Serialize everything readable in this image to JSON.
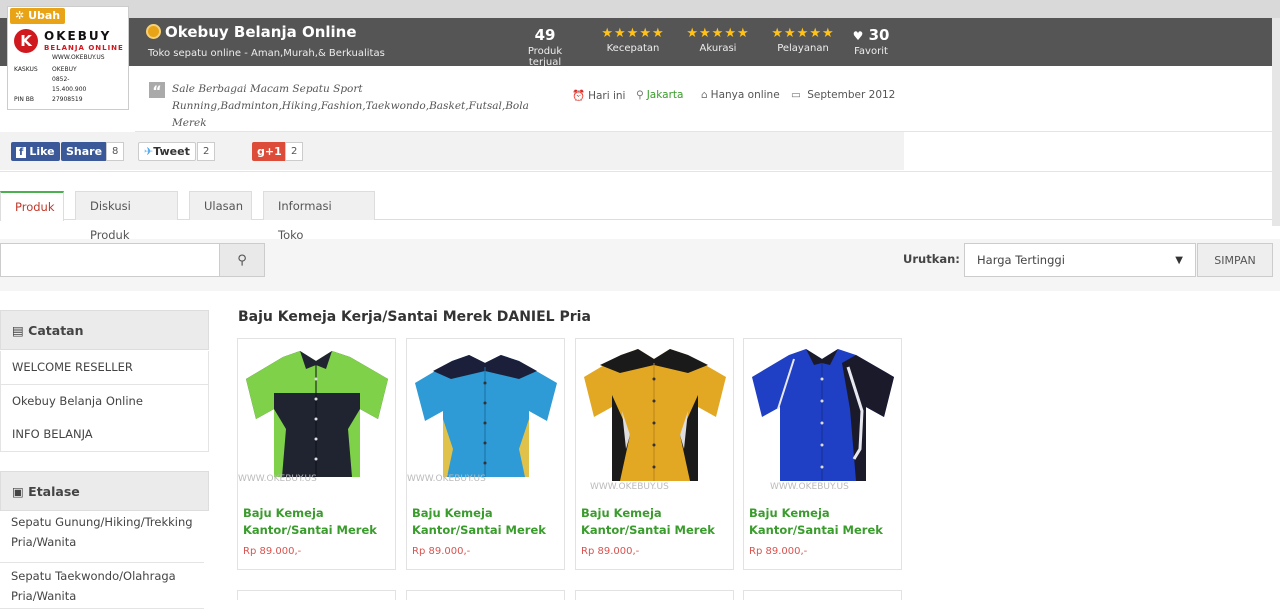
{
  "logo": {
    "edit_label": "Ubah",
    "k_letter": "K",
    "brand": "OKEBUY",
    "subtitle": "BELANJA ONLINE",
    "website": "WWW.OKEBUY.US",
    "lines": [
      {
        "a": "KASKUS",
        "b": "OKEBUY"
      },
      {
        "a": "",
        "b": "0852-15.400.900"
      },
      {
        "a": "PIN BB",
        "b": "27908519"
      }
    ]
  },
  "shop": {
    "name": "Okebuy Belanja Online",
    "tagline": "Toko sepatu online - Aman,Murah,& Berkualitas"
  },
  "stats": {
    "sold_count": "49",
    "sold_label": "Produk terjual",
    "speed_label": "Kecepatan",
    "accuracy_label": "Akurasi",
    "service_label": "Pelayanan",
    "stars": "★★★★★",
    "rating_stars": 5,
    "favorite_count": "30",
    "favorite_label": "Favorit",
    "star_color": "#ffc21a"
  },
  "description": "Sale Berbagai Macam Sepatu Sport Running,Badminton,Hiking,Fashion,Taekwondo,Basket,Futsal,Bola Merek",
  "meta": {
    "time_label": "Hari ini",
    "location_label": "Jakarta",
    "online_label": "Hanya online",
    "since_label": "September 2012"
  },
  "social": {
    "like_label": "Like",
    "share_label": "Share",
    "share_count": "8",
    "tweet_label": "Tweet",
    "tweet_count": "2",
    "gplus_label": "g+1",
    "gplus_count": "2"
  },
  "tabs": [
    {
      "label": "Produk",
      "active": true
    },
    {
      "label": "Diskusi Produk",
      "active": false
    },
    {
      "label": "Ulasan",
      "active": false
    },
    {
      "label": "Informasi Toko",
      "active": false
    }
  ],
  "search": {
    "value": "",
    "placeholder": ""
  },
  "sort": {
    "label": "Urutkan:",
    "selected": "Harga Tertinggi",
    "save_label": "SIMPAN"
  },
  "sidebar": {
    "notes_title": "Catatan",
    "notes": [
      "WELCOME RESELLER",
      "Okebuy Belanja Online",
      "INFO BELANJA"
    ],
    "etalase_title": "Etalase",
    "etalase": [
      "Sepatu Gunung/Hiking/Trekking Pria/Wanita",
      "Sepatu Taekwondo/Olahraga Pria/Wanita"
    ]
  },
  "products": {
    "section_title": "Baju Kemeja Kerja/Santai Merek DANIEL Pria",
    "items": [
      {
        "name": "Baju Kemeja Kantor/Santai Merek",
        "price": "Rp 89.000,-",
        "watermark": "WWW.OKEBUY.US"
      },
      {
        "name": "Baju Kemeja Kantor/Santai Merek",
        "price": "Rp 89.000,-",
        "watermark": "WWW.OKEBUY.US"
      },
      {
        "name": "Baju Kemeja Kantor/Santai Merek",
        "price": "Rp 89.000,-",
        "watermark": "WWW.OKEBUY.US"
      },
      {
        "name": "Baju Kemeja Kantor/Santai Merek",
        "price": "Rp 89.000,-",
        "watermark": "WWW.OKEBUY.US"
      }
    ]
  },
  "colors": {
    "header_bg": "#555555",
    "accent_orange": "#e8a317",
    "product_name": "#3a9c2d",
    "price": "#d9534f",
    "facebook": "#3b5998",
    "twitter": "#55acee",
    "gplus": "#dd4b39"
  }
}
